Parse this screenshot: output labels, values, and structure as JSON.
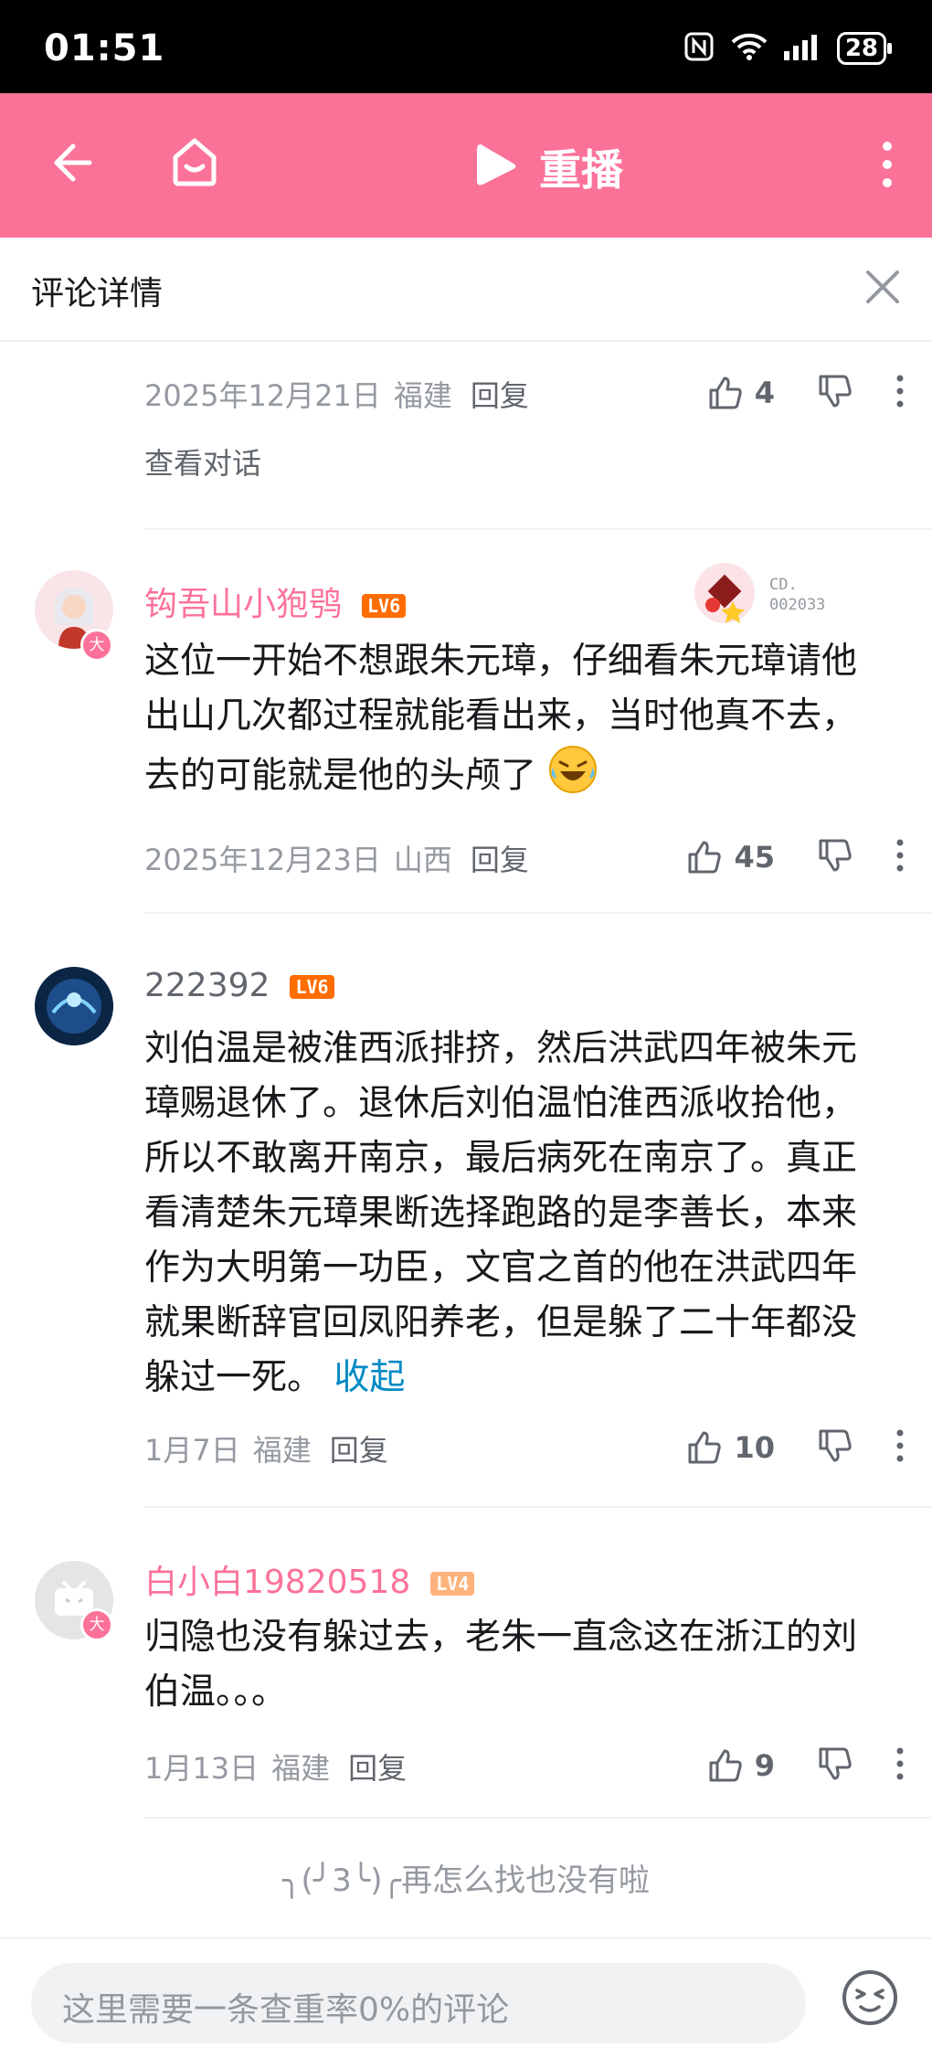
{
  "status_bar": {
    "time": "01:51",
    "battery": "28"
  },
  "top_bar": {
    "replay_label": "重播"
  },
  "panel": {
    "title": "评论详情"
  },
  "first_reply_meta": {
    "date": "2025年12月21日",
    "location": "福建",
    "reply_label": "回复",
    "likes": "4",
    "view_conversation": "查看对话"
  },
  "comments": [
    {
      "username": "钩吾山小狍鸮",
      "level": "LV6",
      "badge_code": "CD.\n002033",
      "text": "这位一开始不想跟朱元璋，仔细看朱元璋请他出山几次都过程就能看出来，当时他真不去，去的可能就是他的头颅了",
      "date": "2025年12月23日",
      "location": "山西",
      "reply_label": "回复",
      "likes": "45"
    },
    {
      "username": "222392",
      "level": "LV6",
      "text": "刘伯温是被淮西派排挤，然后洪武四年被朱元璋赐退休了。退休后刘伯温怕淮西派收拾他，所以不敢离开南京，最后病死在南京了。真正看清楚朱元璋果断选择跑路的是李善长，本来作为大明第一功臣，文官之首的他在洪武四年就果断辞官回凤阳养老，但是躲了二十年都没躲过一死。",
      "collapse_label": "收起",
      "date": "1月7日",
      "location": "福建",
      "reply_label": "回复",
      "likes": "10"
    },
    {
      "username": "白小白19820518",
      "level": "LV4",
      "text": "归隐也没有躲过去，老朱一直念这在浙江的刘伯温。。。",
      "date": "1月13日",
      "location": "福建",
      "reply_label": "回复",
      "likes": "9"
    }
  ],
  "avatar_badge": "大",
  "end_hint": "╮(╯3╰)╭再怎么找也没有啦",
  "input": {
    "placeholder": "这里需要一条查重率0%的评论"
  },
  "colors": {
    "brand_pink": "#fb7299",
    "lv6": "#ff6c00",
    "lv4": "#ffb37c",
    "link": "#008ac5"
  }
}
